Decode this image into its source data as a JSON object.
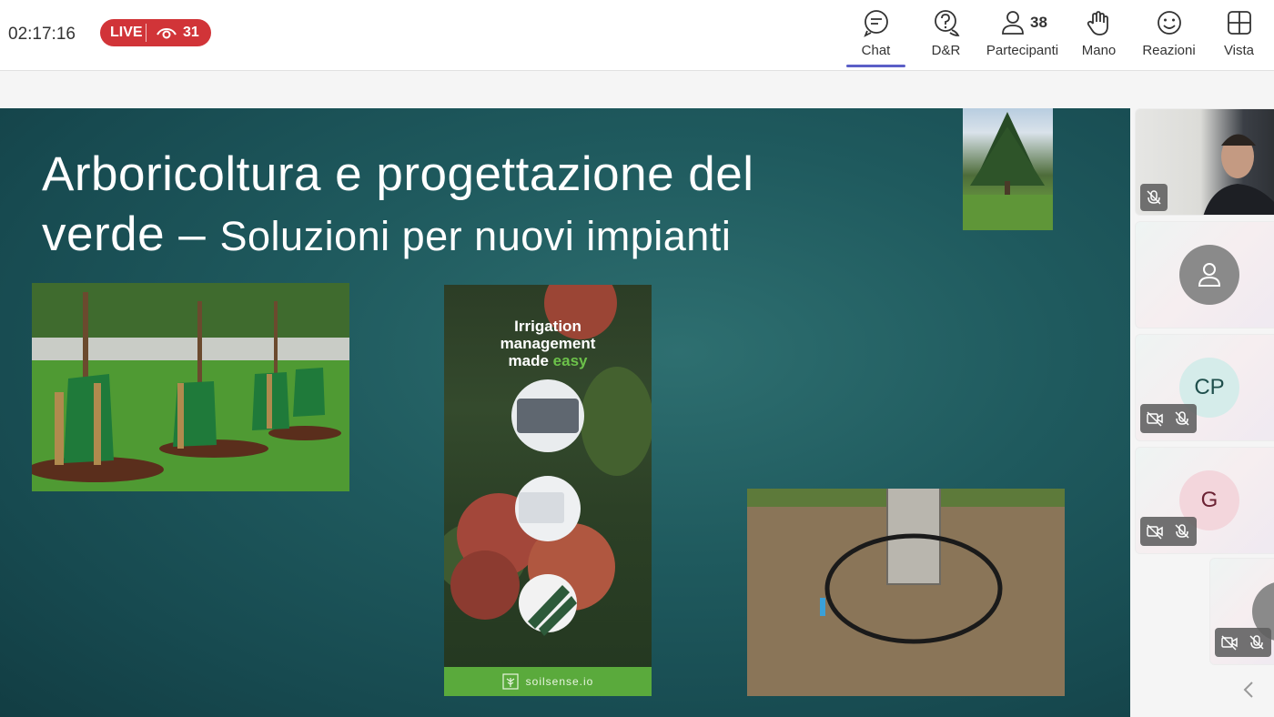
{
  "header": {
    "timer": "02:17:16",
    "live_label": "LIVE",
    "viewer_count": "31"
  },
  "toolbar": {
    "chat_label": "Chat",
    "qa_label": "D&R",
    "participants_label": "Partecipanti",
    "participants_count": "38",
    "hand_label": "Mano",
    "reactions_label": "Reazioni",
    "view_label": "Vista"
  },
  "slide": {
    "title_line1": "Arboricoltura e progettazione del",
    "title_line2_main": "verde – ",
    "title_line2_sub": "Soluzioni per nuovi impianti",
    "poster": {
      "line1": "Irrigation",
      "line2": "management",
      "line3_a": "made ",
      "line3_b": "easy",
      "footer": "soilsense.io"
    }
  },
  "gallery": {
    "tiles": [
      {
        "type": "video"
      },
      {
        "type": "avatar",
        "initials": ""
      },
      {
        "type": "avatar",
        "initials": "CP"
      },
      {
        "type": "avatar",
        "initials": "G"
      }
    ]
  },
  "colors": {
    "live_red": "#d13438",
    "accent": "#5b5fc7",
    "slide_teal": "#1f5a5e"
  }
}
